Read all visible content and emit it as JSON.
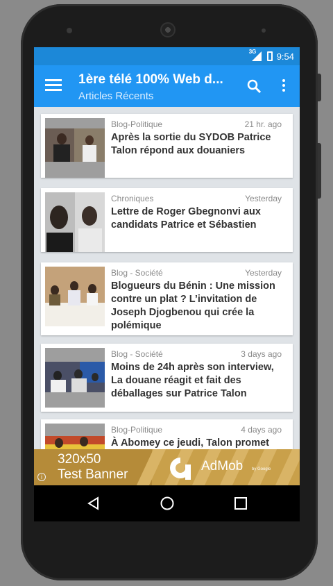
{
  "statusbar": {
    "network": "3G",
    "time": "9:54"
  },
  "appbar": {
    "title": "1ère télé 100% Web d...",
    "subtitle": "Articles Récents"
  },
  "articles": [
    {
      "category": "Blog-Politique",
      "time": "21 hr. ago",
      "headline": "Après la sortie du SYDOB Patrice Talon répond aux douaniers"
    },
    {
      "category": "Chroniques",
      "time": "Yesterday",
      "headline": "Lettre de Roger Gbegnonvi aux candidats Patrice et Sébastien"
    },
    {
      "category": "Blog - Société",
      "time": "Yesterday",
      "headline": "Blogueurs du Bénin : Une mission contre un plat ? L’invitation de Joseph Djogbenou qui crée la polémique"
    },
    {
      "category": "Blog - Société",
      "time": "3 days ago",
      "headline": "Moins de 24h après son interview, La douane réagit et fait des déballages sur Patrice Talon"
    },
    {
      "category": "Blog-Politique",
      "time": "4 days ago",
      "headline": "À Abomey ce jeudi, Talon promet"
    }
  ],
  "ad": {
    "line1": "320x50",
    "line2": "Test Banner",
    "brand": "AdMob",
    "by": "by Google",
    "info": "i"
  },
  "icons": {
    "menu": "hamburger-icon",
    "search": "search-icon",
    "more": "more-vert-icon",
    "back": "back-icon",
    "home": "home-icon",
    "recents": "recents-icon"
  },
  "colors": {
    "appbar": "#2196f3",
    "statusbar": "#1c88d8"
  }
}
